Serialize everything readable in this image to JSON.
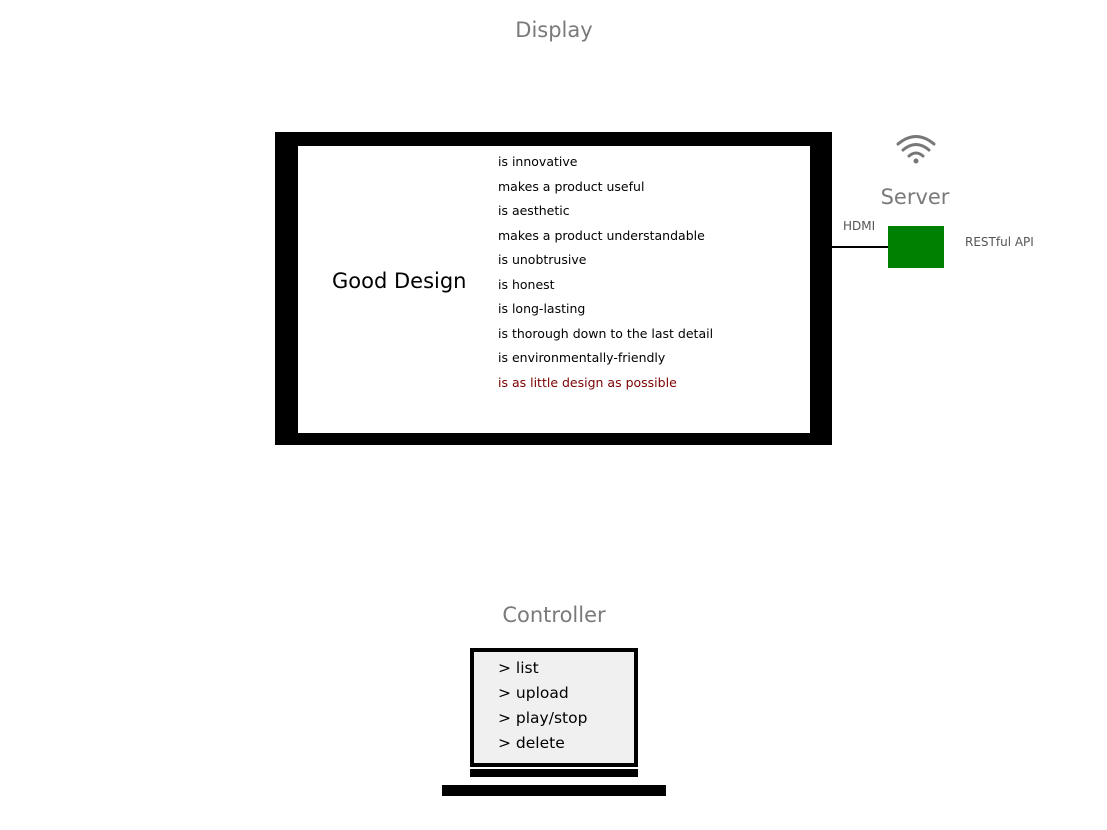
{
  "display": {
    "title": "Display",
    "slide": {
      "title": "Good Design",
      "principles": [
        "is innovative",
        "makes a product useful",
        "is aesthetic",
        "makes a product understandable",
        "is unobtrusive",
        "is honest",
        "is long-lasting",
        "is thorough down to the last detail",
        "is environmentally-friendly",
        "is as little design as possible"
      ],
      "highlight_color": "#7a0000"
    }
  },
  "connection": {
    "label": "HDMI"
  },
  "server": {
    "title": "Server",
    "icon": "wifi-icon",
    "api_label": "RESTful API",
    "color": "#008000"
  },
  "controller": {
    "title": "Controller",
    "commands": [
      "> list",
      "> upload",
      "> play/stop",
      "> delete"
    ]
  }
}
